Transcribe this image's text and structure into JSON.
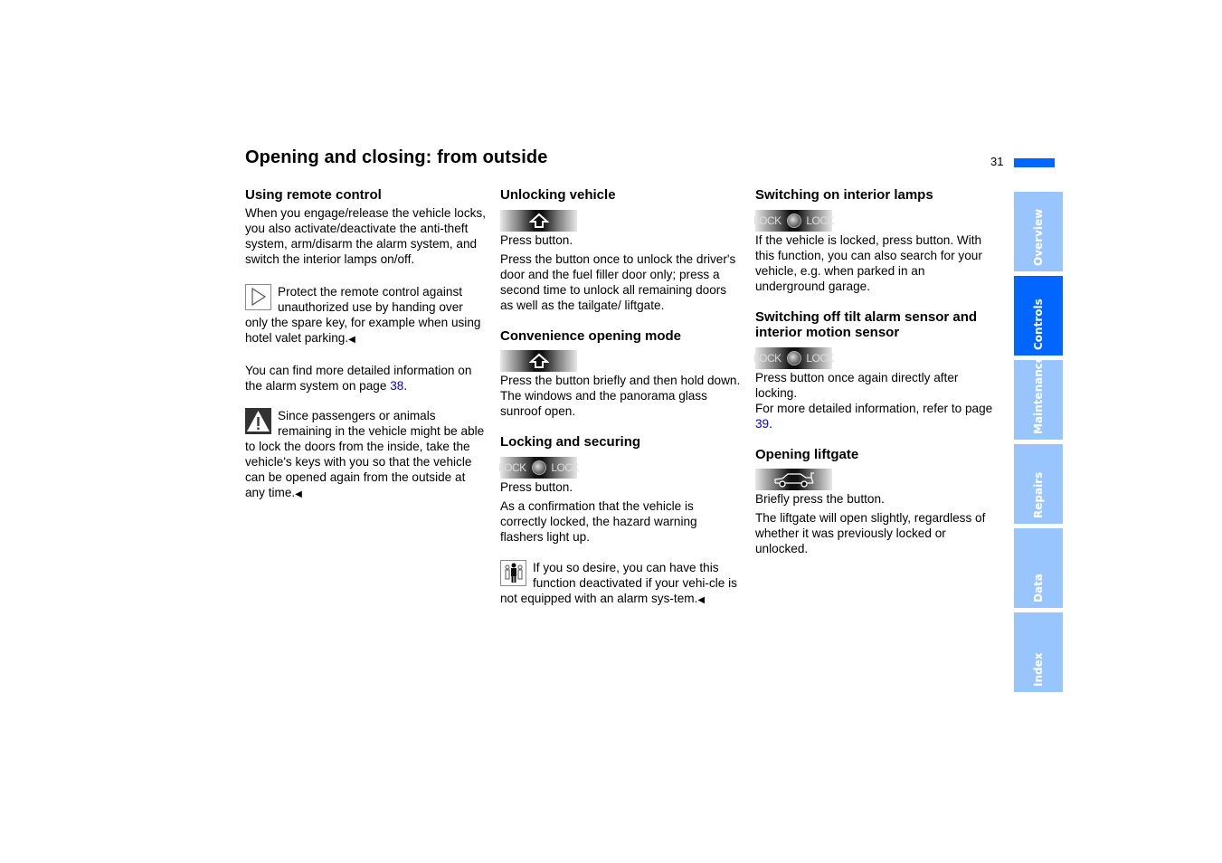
{
  "page": {
    "title": "Opening and closing: from outside",
    "number": "31"
  },
  "tabs": [
    {
      "label": "Overview",
      "active": false
    },
    {
      "label": "Controls",
      "active": true
    },
    {
      "label": "Maintenance",
      "active": false
    },
    {
      "label": "Repairs",
      "active": false
    },
    {
      "label": "Data",
      "active": false
    },
    {
      "label": "Index",
      "active": false
    }
  ],
  "col1": {
    "heading": "Using remote control",
    "intro": "When you engage/release the vehicle locks, you also activate/deactivate the anti-theft system, arm/disarm the alarm system, and switch the interior lamps on/off.",
    "note": "Protect the remote control against unauthorized use by handing over only the spare key, for example when using hotel valet parking.",
    "more_info_pre": "You can find more detailed information on the alarm system on page ",
    "more_info_link": "38",
    "more_info_post": ".",
    "warning": "Since passengers or animals remaining in the vehicle might be able to lock the doors from the inside, take the vehicle's keys with you so that the vehicle can be opened again from the outside at any time."
  },
  "col2": {
    "unlock": {
      "heading": "Unlocking vehicle",
      "step": "Press button.",
      "body": "Press the button once to unlock the driver's door and the fuel filler door only; press a second time to unlock all remaining doors as well as the tailgate/ liftgate."
    },
    "convenience": {
      "heading": "Convenience opening mode",
      "body1": "Press the button briefly and then hold down.",
      "body2": "The windows and the panorama glass sunroof open."
    },
    "locking": {
      "heading": "Locking and securing",
      "step": "Press button.",
      "body": "As a confirmation that the vehicle is correctly locked, the hazard warning flashers light up."
    },
    "note": "If you so desire, you can have this function deactivated if your vehi-cle is not equipped with an alarm sys-tem."
  },
  "col3": {
    "lamps": {
      "heading": "Switching on interior lamps",
      "body": "If the vehicle is locked, press button. With this function, you can also search for your vehicle, e.g. when parked in an underground garage."
    },
    "tilt": {
      "heading": "Switching off tilt alarm sensor and interior motion sensor",
      "body1": "Press button once again directly after locking.",
      "body2_pre": "For more detailed information, refer to page ",
      "body2_link": "39",
      "body2_post": "."
    },
    "liftgate": {
      "heading": "Opening liftgate",
      "step": "Briefly press the button.",
      "body": "The liftgate will open slightly, regardless of whether it was previously locked or unlocked."
    }
  },
  "button_labels": {
    "lock": "LOCK"
  },
  "end_mark": "◀",
  "colors": {
    "accent": "#0066ff",
    "tab_inactive": "#99c5ff",
    "link": "#0000cc"
  }
}
